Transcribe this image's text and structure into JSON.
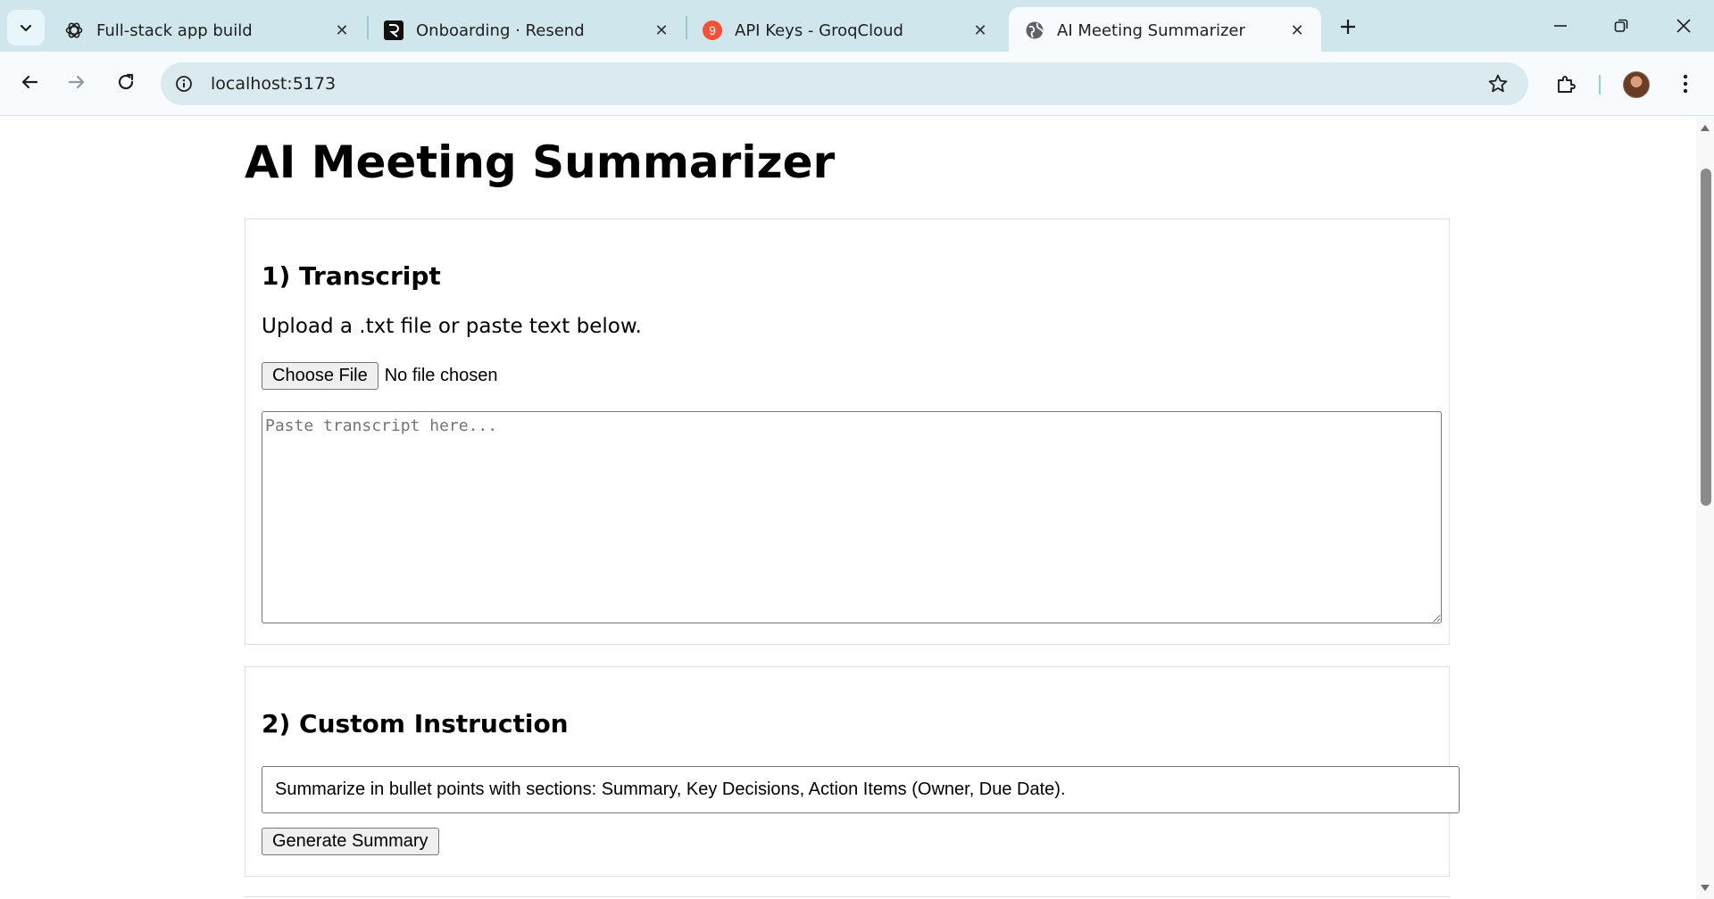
{
  "browser": {
    "tabs": [
      {
        "title": "Full-stack app build",
        "favicon": "openai-icon"
      },
      {
        "title": "Onboarding · Resend",
        "favicon": "resend-icon"
      },
      {
        "title": "API Keys - GroqCloud",
        "favicon": "groq-icon",
        "favicon_text": "9"
      },
      {
        "title": "AI Meeting Summarizer",
        "favicon": "globe-icon",
        "active": true
      }
    ],
    "url": "localhost:5173"
  },
  "app": {
    "title": "AI Meeting Summarizer",
    "transcript_section": {
      "heading": "1) Transcript",
      "description": "Upload a .txt file or paste text below.",
      "choose_file_label": "Choose File",
      "file_status": "No file chosen",
      "textarea_placeholder": "Paste transcript here...",
      "textarea_value": ""
    },
    "instruction_section": {
      "heading": "2) Custom Instruction",
      "instruction_value": "Summarize in bullet points with sections: Summary, Key Decisions, Action Items (Owner, Due Date).",
      "generate_label": "Generate Summary"
    }
  },
  "colors": {
    "tabstrip": "#cfe6ec",
    "toolbar": "#f8fbfd",
    "omnibox": "#dbeaef",
    "groq_badge": "#f55036"
  }
}
